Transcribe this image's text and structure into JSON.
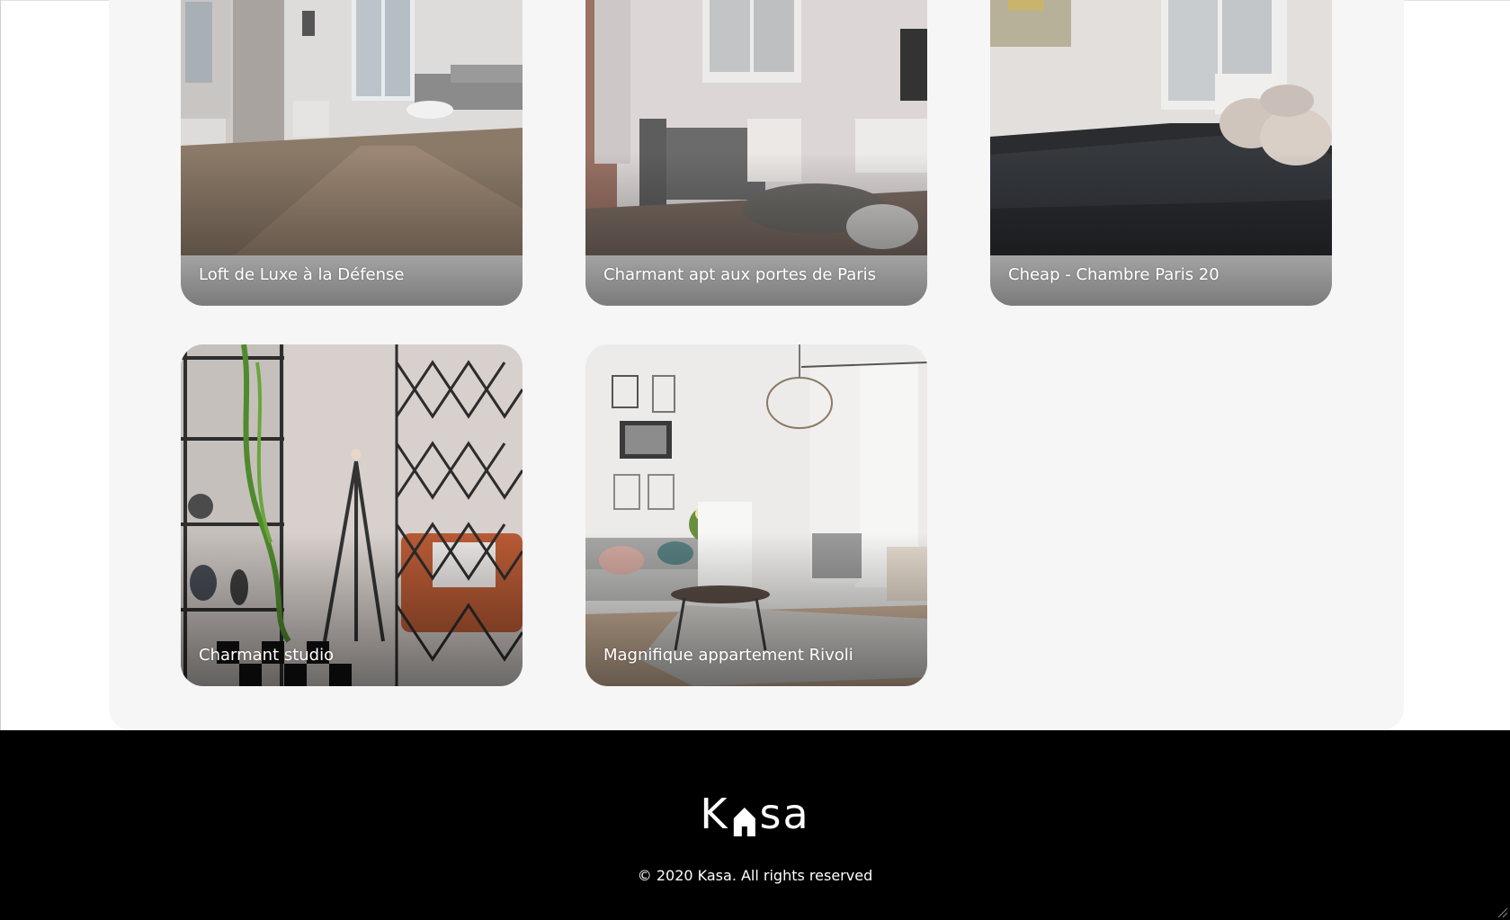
{
  "app": {
    "name": "Kasa"
  },
  "colors": {
    "accent": "#ff6060",
    "footer_bg": "#000000",
    "gallery_bg": "#f6f6f6",
    "text_light": "#ffffff"
  },
  "listings": [
    {
      "title": "Loft de Luxe à la Défense"
    },
    {
      "title": "Charmant apt aux portes de Paris"
    },
    {
      "title": "Cheap - Chambre Paris 20"
    },
    {
      "title": "Charmant studio"
    },
    {
      "title": "Magnifique appartement Rivoli"
    }
  ],
  "footer": {
    "logo_text_left": "K",
    "logo_text_right": "sa",
    "copyright": "© 2020 Kasa. All rights reserved"
  }
}
